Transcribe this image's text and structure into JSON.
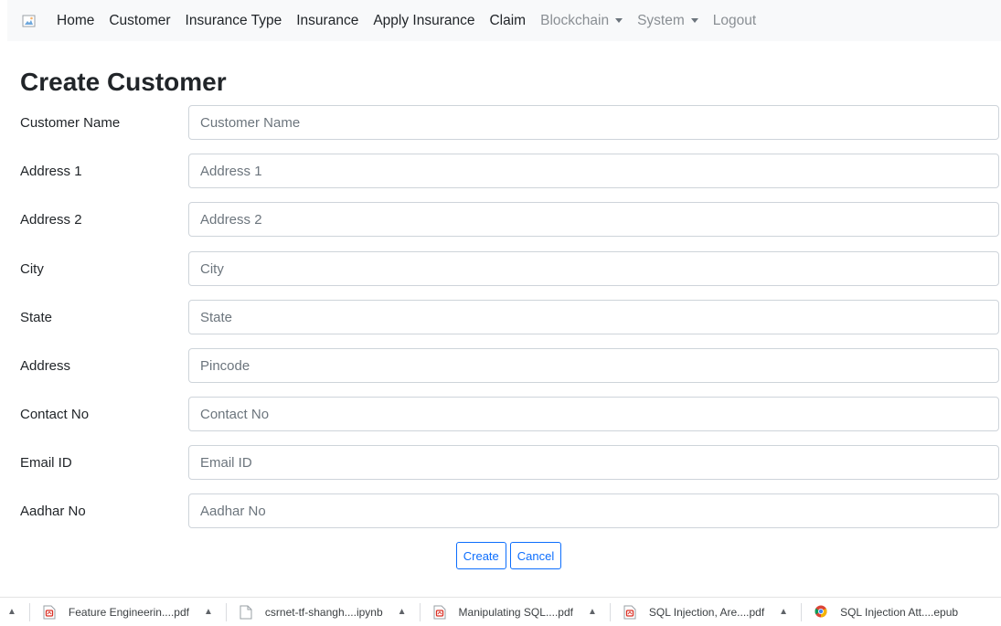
{
  "nav": {
    "items": [
      {
        "label": "Home",
        "muted": false
      },
      {
        "label": "Customer",
        "muted": false
      },
      {
        "label": "Insurance Type",
        "muted": false
      },
      {
        "label": "Insurance",
        "muted": false
      },
      {
        "label": "Apply Insurance",
        "muted": false
      },
      {
        "label": "Claim",
        "muted": false
      },
      {
        "label": "Blockchain",
        "muted": true
      },
      {
        "label": "System",
        "muted": true
      },
      {
        "label": "Logout",
        "muted": true
      }
    ]
  },
  "page": {
    "title": "Create Customer"
  },
  "form": {
    "fields": [
      {
        "label": "Customer Name",
        "placeholder": "Customer Name"
      },
      {
        "label": "Address 1",
        "placeholder": "Address 1"
      },
      {
        "label": "Address 2",
        "placeholder": "Address 2"
      },
      {
        "label": "City",
        "placeholder": "City"
      },
      {
        "label": "State",
        "placeholder": "State"
      },
      {
        "label": "Address",
        "placeholder": "Pincode"
      },
      {
        "label": "Contact No",
        "placeholder": "Contact No"
      },
      {
        "label": "Email ID",
        "placeholder": "Email ID"
      },
      {
        "label": "Aadhar No",
        "placeholder": "Aadhar No"
      }
    ],
    "create_label": "Create",
    "cancel_label": "Cancel"
  },
  "downloads": {
    "items": [
      {
        "name": "Feature Engineerin....pdf",
        "icon": "pdf-icon"
      },
      {
        "name": "csrnet-tf-shangh....ipynb",
        "icon": "file-icon"
      },
      {
        "name": "Manipulating SQL....pdf",
        "icon": "pdf-icon"
      },
      {
        "name": "SQL Injection, Are....pdf",
        "icon": "pdf-icon"
      },
      {
        "name": "SQL Injection Att....epub",
        "icon": "chrome-icon"
      }
    ]
  }
}
